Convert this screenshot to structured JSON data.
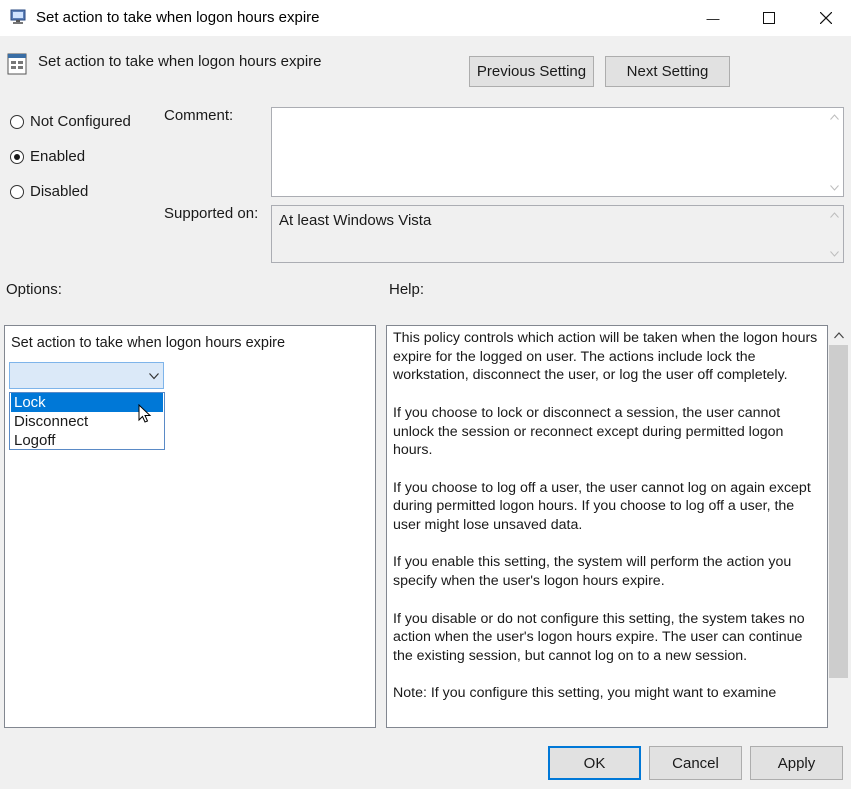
{
  "window": {
    "title": "Set action to take when logon hours expire",
    "minimize_glyph": "—",
    "maximize_glyph": "☐",
    "close_glyph": "✕"
  },
  "header": {
    "title": "Set action to take when logon hours expire",
    "previous_label": "Previous Setting",
    "next_label": "Next Setting"
  },
  "state": {
    "options": [
      {
        "label": "Not Configured",
        "selected": false
      },
      {
        "label": "Enabled",
        "selected": true
      },
      {
        "label": "Disabled",
        "selected": false
      }
    ]
  },
  "comment": {
    "label": "Comment:",
    "value": ""
  },
  "supported": {
    "label": "Supported on:",
    "value": "At least Windows Vista"
  },
  "options_section": {
    "label": "Options:",
    "setting_label": "Set action to take when logon hours expire",
    "combo_value": "",
    "dropdown_items": [
      "Lock",
      "Disconnect",
      "Logoff"
    ],
    "highlighted_item": "Lock"
  },
  "help": {
    "label": "Help:",
    "text": "This policy controls which action will be taken when the logon hours expire for the logged on user. The actions include lock the workstation, disconnect the user, or log the user off completely.\n\nIf you choose to lock or disconnect a session, the user cannot unlock the session or reconnect except during permitted logon hours.\n\nIf you choose to log off a user, the user cannot log on again except during permitted logon hours. If you choose to log off a user, the user might lose unsaved data.\n\nIf you enable this setting, the system will perform the action you specify when the user's logon hours expire.\n\nIf you disable or do not configure this setting, the system takes no action when the user's logon hours expire. The user can continue the existing session, but cannot log on to a new session.\n\nNote: If you configure this setting, you might want to examine"
  },
  "footer": {
    "ok_label": "OK",
    "cancel_label": "Cancel",
    "apply_label": "Apply"
  },
  "colors": {
    "selection": "#0078d7",
    "focus_border": "#0078d7",
    "window_bg": "#f0f0f0"
  }
}
